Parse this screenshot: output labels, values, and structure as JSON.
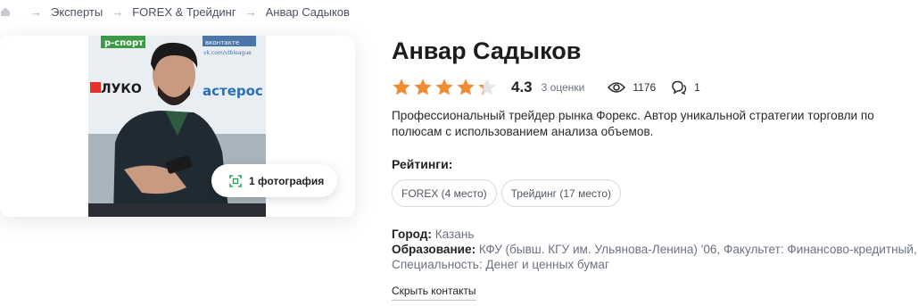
{
  "breadcrumb": {
    "items": [
      "Эксперты",
      "FOREX & Трейдинг",
      "Анвар Садыков"
    ]
  },
  "photo": {
    "button_label": "1 фотография",
    "backdrop_texts": [
      "р-спорт",
      "вконтакте",
      "vk.com/vtbleague",
      "ЛУКО",
      "астерос"
    ]
  },
  "profile": {
    "name": "Анвар Садыков",
    "rating": "4.3",
    "rating_value": 4.3,
    "rating_max": 5,
    "ratings_count": "3 оценки",
    "views": "1176",
    "comments": "1",
    "description": "Профессиональный трейдер рынка Форекс. Автор уникальной стратегии торговли по полюсам с использованием анализа объемов.",
    "ratings_label": "Рейтинги:",
    "chips": [
      "FOREX (4 место)",
      "Трейдинг (17 место)"
    ],
    "city_label": "Город:",
    "city": "Казань",
    "education_label": "Образование:",
    "education": "КФУ (бывш. КГУ им. Ульянова-Ленина) '06, Факультет: Финансово-кредитный, Специальность: Денег и ценных бумаг",
    "hide_contacts": "Скрыть контакты"
  },
  "colors": {
    "star": "#f28c33",
    "star_empty": "#e2e4e8",
    "photo_button_icon": "#22a559"
  },
  "icons": [
    "home-icon",
    "arrow-right-icon",
    "gallery-icon",
    "star-icon",
    "eye-icon",
    "comment-icon"
  ]
}
